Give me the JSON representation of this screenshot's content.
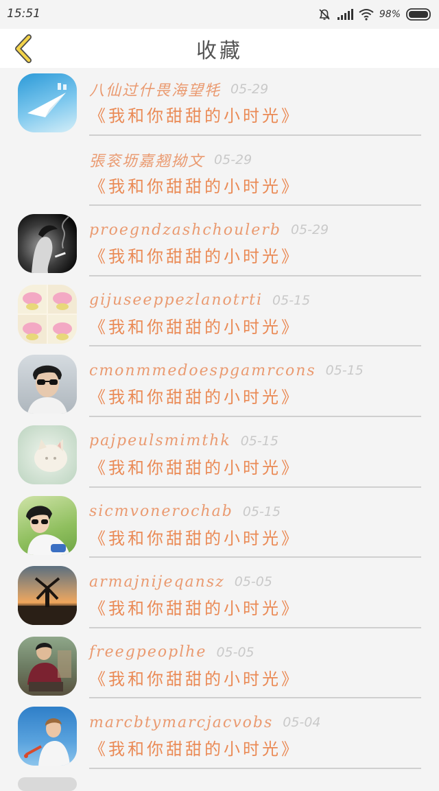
{
  "status": {
    "time": "15:51",
    "battery": "98%"
  },
  "header": {
    "title": "收藏"
  },
  "items": [
    {
      "name": "八仙过什畏海望牦",
      "date": "05-29",
      "title": "《我和你甜甜的小时光》",
      "avatar": "paper-plane-avatar"
    },
    {
      "name": "張衮坜嘉翘拗文",
      "date": "05-29",
      "title": "《我和你甜甜的小时光》",
      "avatar": "none"
    },
    {
      "name": "proegndzashchoulerb",
      "date": "05-29",
      "title": "《我和你甜甜的小时光》",
      "avatar": "smoking-woman-avatar"
    },
    {
      "name": "gijuseeppezlanotrti",
      "date": "05-15",
      "title": "《我和你甜甜的小时光》",
      "avatar": "pink-cartoon-avatar"
    },
    {
      "name": "cmonmmedoespgamrcons",
      "date": "05-15",
      "title": "《我和你甜甜的小时光》",
      "avatar": "sunglasses-man-avatar"
    },
    {
      "name": "pajpeulsmimthk",
      "date": "05-15",
      "title": "《我和你甜甜的小时光》",
      "avatar": "cat-avatar"
    },
    {
      "name": "sicmvonerochab",
      "date": "05-15",
      "title": "《我和你甜甜的小时光》",
      "avatar": "boy-grass-avatar"
    },
    {
      "name": "armajnijeqansz",
      "date": "05-05",
      "title": "《我和你甜甜的小时光》",
      "avatar": "windmill-sunset-avatar"
    },
    {
      "name": "freegpeoplhe",
      "date": "05-05",
      "title": "《我和你甜甜的小时光》",
      "avatar": "sitting-man-avatar"
    },
    {
      "name": "marcbtymarcjacvobs",
      "date": "05-04",
      "title": "《我和你甜甜的小时光》",
      "avatar": "blue-sky-man-avatar"
    }
  ]
}
